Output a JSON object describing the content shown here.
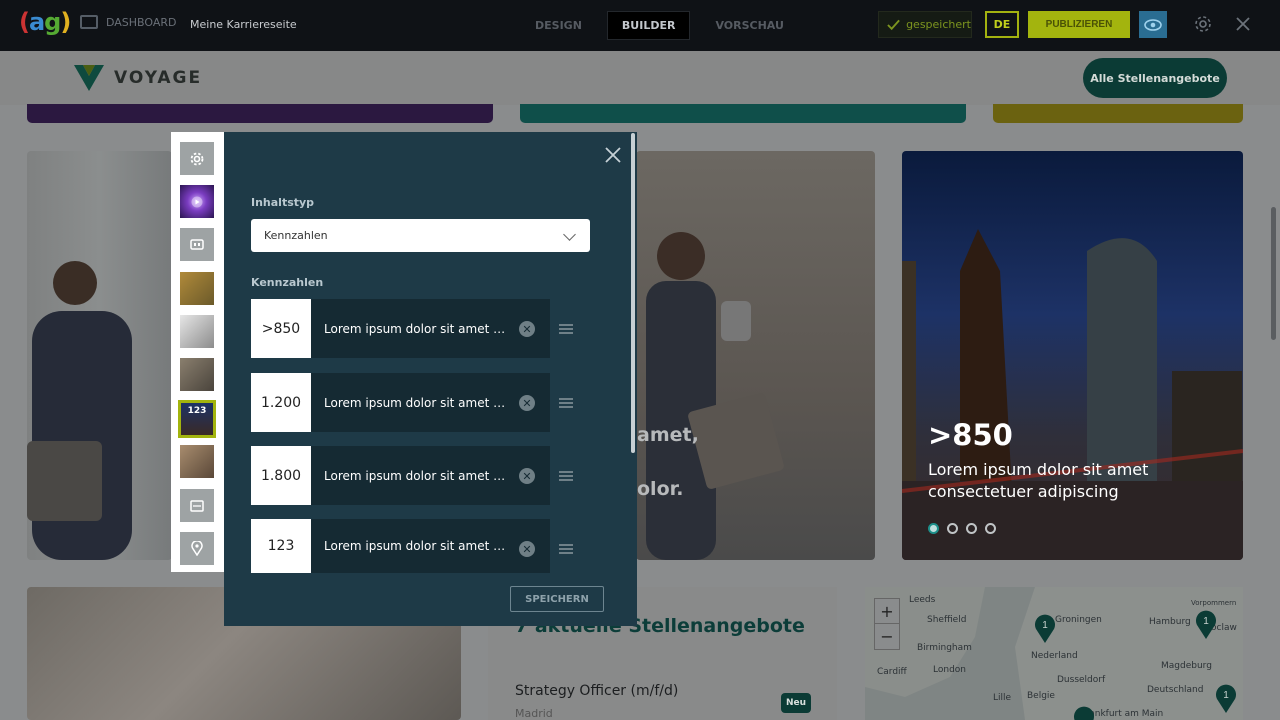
{
  "topbar": {
    "dashboard_label": "DASHBOARD",
    "breadcrumb": "Meine Karriereseite",
    "modes": [
      "DESIGN",
      "BUILDER",
      "VORSCHAU"
    ],
    "active_mode": "BUILDER",
    "saved_status": "gespeichert",
    "language": "DE",
    "publish_label": "PUBLIZIEREN"
  },
  "site": {
    "brand": "VOYAGE",
    "all_jobs_button": "Alle Stellenangebote"
  },
  "background_text": {
    "fragment_1": "amet,",
    "fragment_2": "olor."
  },
  "slider": {
    "number": ">850",
    "caption_line1": "Lorem ipsum dolor sit amet",
    "caption_line2": "consectetuer adipiscing",
    "dots": 4,
    "active_dot": 0
  },
  "modal": {
    "content_type_label": "Inhaltstyp",
    "content_type_value": "Kennzahlen",
    "figures_label": "Kennzahlen",
    "rows": [
      {
        "value": ">850",
        "text": "Lorem ipsum dolor sit amet co..."
      },
      {
        "value": "1.200",
        "text": "Lorem ipsum dolor sit amet co..."
      },
      {
        "value": "1.800",
        "text": "Lorem ipsum dolor sit amet co..."
      },
      {
        "value": "123",
        "text": "Lorem ipsum dolor sit amet co..."
      }
    ],
    "save_label": "SPEICHERN",
    "sidebar_selected_badge": "123"
  },
  "jobs": {
    "heading": "7 aktuelle Stellenangebote",
    "job_title": "Strategy Officer (m/f/d)",
    "job_location": "Madrid",
    "badge": "Neu"
  },
  "map": {
    "zoom_in": "+",
    "zoom_out": "−",
    "cities": [
      "Leeds",
      "Sheffield",
      "Birmingham",
      "London",
      "Cardiff",
      "Groningen",
      "Hamburg",
      "Nederland",
      "Dusseldorf",
      "Belgie",
      "Frankfurt am Main",
      "Magdeburg",
      "Deutschland",
      "Lille",
      "Wroclaw",
      "Vorpommern"
    ],
    "pin_count": "1"
  }
}
